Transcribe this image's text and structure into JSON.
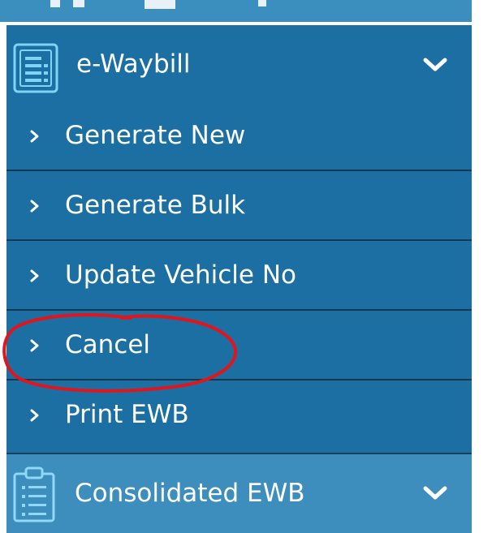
{
  "colors": {
    "sidebar_bg": "#1b6fa3",
    "consolidated_bg": "#3d8ebd",
    "divider": "#16384f",
    "text": "#ffffff",
    "icon_accent": "#7fd3f5",
    "annotation": "#e3141a"
  },
  "ewaybill": {
    "label": "e-Waybill",
    "icon": "document-list-icon",
    "expanded": true,
    "items": [
      {
        "label": "Generate New"
      },
      {
        "label": "Generate Bulk"
      },
      {
        "label": "Update Vehicle No"
      },
      {
        "label": "Cancel",
        "annotated": true
      },
      {
        "label": "Print EWB"
      }
    ]
  },
  "consolidated": {
    "label": "Consolidated EWB",
    "icon": "clipboard-list-icon"
  }
}
